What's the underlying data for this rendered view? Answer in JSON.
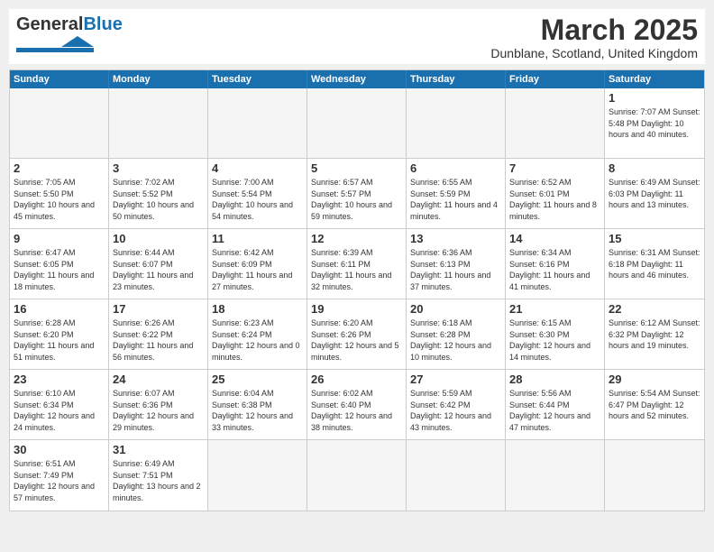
{
  "header": {
    "logo_general": "General",
    "logo_blue": "Blue",
    "month_title": "March 2025",
    "location": "Dunblane, Scotland, United Kingdom"
  },
  "days_of_week": [
    "Sunday",
    "Monday",
    "Tuesday",
    "Wednesday",
    "Thursday",
    "Friday",
    "Saturday"
  ],
  "weeks": [
    [
      {
        "day": "",
        "info": ""
      },
      {
        "day": "",
        "info": ""
      },
      {
        "day": "",
        "info": ""
      },
      {
        "day": "",
        "info": ""
      },
      {
        "day": "",
        "info": ""
      },
      {
        "day": "",
        "info": ""
      },
      {
        "day": "1",
        "info": "Sunrise: 7:07 AM\nSunset: 5:48 PM\nDaylight: 10 hours and 40 minutes."
      }
    ],
    [
      {
        "day": "2",
        "info": "Sunrise: 7:05 AM\nSunset: 5:50 PM\nDaylight: 10 hours and 45 minutes."
      },
      {
        "day": "3",
        "info": "Sunrise: 7:02 AM\nSunset: 5:52 PM\nDaylight: 10 hours and 50 minutes."
      },
      {
        "day": "4",
        "info": "Sunrise: 7:00 AM\nSunset: 5:54 PM\nDaylight: 10 hours and 54 minutes."
      },
      {
        "day": "5",
        "info": "Sunrise: 6:57 AM\nSunset: 5:57 PM\nDaylight: 10 hours and 59 minutes."
      },
      {
        "day": "6",
        "info": "Sunrise: 6:55 AM\nSunset: 5:59 PM\nDaylight: 11 hours and 4 minutes."
      },
      {
        "day": "7",
        "info": "Sunrise: 6:52 AM\nSunset: 6:01 PM\nDaylight: 11 hours and 8 minutes."
      },
      {
        "day": "8",
        "info": "Sunrise: 6:49 AM\nSunset: 6:03 PM\nDaylight: 11 hours and 13 minutes."
      }
    ],
    [
      {
        "day": "9",
        "info": "Sunrise: 6:47 AM\nSunset: 6:05 PM\nDaylight: 11 hours and 18 minutes."
      },
      {
        "day": "10",
        "info": "Sunrise: 6:44 AM\nSunset: 6:07 PM\nDaylight: 11 hours and 23 minutes."
      },
      {
        "day": "11",
        "info": "Sunrise: 6:42 AM\nSunset: 6:09 PM\nDaylight: 11 hours and 27 minutes."
      },
      {
        "day": "12",
        "info": "Sunrise: 6:39 AM\nSunset: 6:11 PM\nDaylight: 11 hours and 32 minutes."
      },
      {
        "day": "13",
        "info": "Sunrise: 6:36 AM\nSunset: 6:13 PM\nDaylight: 11 hours and 37 minutes."
      },
      {
        "day": "14",
        "info": "Sunrise: 6:34 AM\nSunset: 6:16 PM\nDaylight: 11 hours and 41 minutes."
      },
      {
        "day": "15",
        "info": "Sunrise: 6:31 AM\nSunset: 6:18 PM\nDaylight: 11 hours and 46 minutes."
      }
    ],
    [
      {
        "day": "16",
        "info": "Sunrise: 6:28 AM\nSunset: 6:20 PM\nDaylight: 11 hours and 51 minutes."
      },
      {
        "day": "17",
        "info": "Sunrise: 6:26 AM\nSunset: 6:22 PM\nDaylight: 11 hours and 56 minutes."
      },
      {
        "day": "18",
        "info": "Sunrise: 6:23 AM\nSunset: 6:24 PM\nDaylight: 12 hours and 0 minutes."
      },
      {
        "day": "19",
        "info": "Sunrise: 6:20 AM\nSunset: 6:26 PM\nDaylight: 12 hours and 5 minutes."
      },
      {
        "day": "20",
        "info": "Sunrise: 6:18 AM\nSunset: 6:28 PM\nDaylight: 12 hours and 10 minutes."
      },
      {
        "day": "21",
        "info": "Sunrise: 6:15 AM\nSunset: 6:30 PM\nDaylight: 12 hours and 14 minutes."
      },
      {
        "day": "22",
        "info": "Sunrise: 6:12 AM\nSunset: 6:32 PM\nDaylight: 12 hours and 19 minutes."
      }
    ],
    [
      {
        "day": "23",
        "info": "Sunrise: 6:10 AM\nSunset: 6:34 PM\nDaylight: 12 hours and 24 minutes."
      },
      {
        "day": "24",
        "info": "Sunrise: 6:07 AM\nSunset: 6:36 PM\nDaylight: 12 hours and 29 minutes."
      },
      {
        "day": "25",
        "info": "Sunrise: 6:04 AM\nSunset: 6:38 PM\nDaylight: 12 hours and 33 minutes."
      },
      {
        "day": "26",
        "info": "Sunrise: 6:02 AM\nSunset: 6:40 PM\nDaylight: 12 hours and 38 minutes."
      },
      {
        "day": "27",
        "info": "Sunrise: 5:59 AM\nSunset: 6:42 PM\nDaylight: 12 hours and 43 minutes."
      },
      {
        "day": "28",
        "info": "Sunrise: 5:56 AM\nSunset: 6:44 PM\nDaylight: 12 hours and 47 minutes."
      },
      {
        "day": "29",
        "info": "Sunrise: 5:54 AM\nSunset: 6:47 PM\nDaylight: 12 hours and 52 minutes."
      }
    ],
    [
      {
        "day": "30",
        "info": "Sunrise: 6:51 AM\nSunset: 7:49 PM\nDaylight: 12 hours and 57 minutes."
      },
      {
        "day": "31",
        "info": "Sunrise: 6:49 AM\nSunset: 7:51 PM\nDaylight: 13 hours and 2 minutes."
      },
      {
        "day": "",
        "info": ""
      },
      {
        "day": "",
        "info": ""
      },
      {
        "day": "",
        "info": ""
      },
      {
        "day": "",
        "info": ""
      },
      {
        "day": "",
        "info": ""
      }
    ]
  ]
}
